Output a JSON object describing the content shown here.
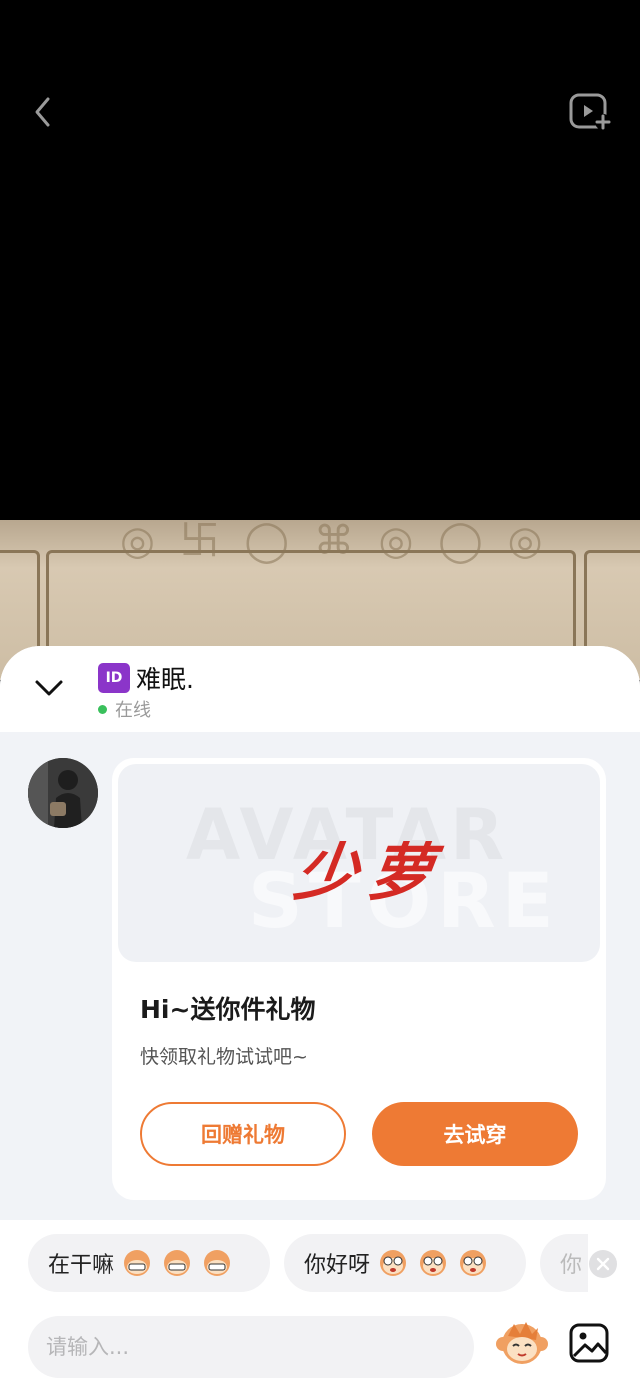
{
  "top_bar": {
    "back_icon": "chevron-left-icon",
    "record_icon": "video-add-icon"
  },
  "header": {
    "badge": "ID",
    "peer_name": "难眠.",
    "status": "在线",
    "status_color": "#3ac05c",
    "collapse_icon": "chevron-down-icon"
  },
  "gift_card": {
    "brand_logo": "少萝",
    "title": "Hi~送你件礼物",
    "subtitle": "快领取礼物试试吧~",
    "return_label": "回赠礼物",
    "try_label": "去试穿",
    "accent_color": "#ee7a34"
  },
  "quick_replies": [
    {
      "text": "在干嘛",
      "emoji": "grin-monkey-icon"
    },
    {
      "text": "你好呀",
      "emoji": "nerd-monkey-icon"
    },
    {
      "text": "你",
      "emoji": ""
    }
  ],
  "input": {
    "placeholder": "请输入..."
  }
}
